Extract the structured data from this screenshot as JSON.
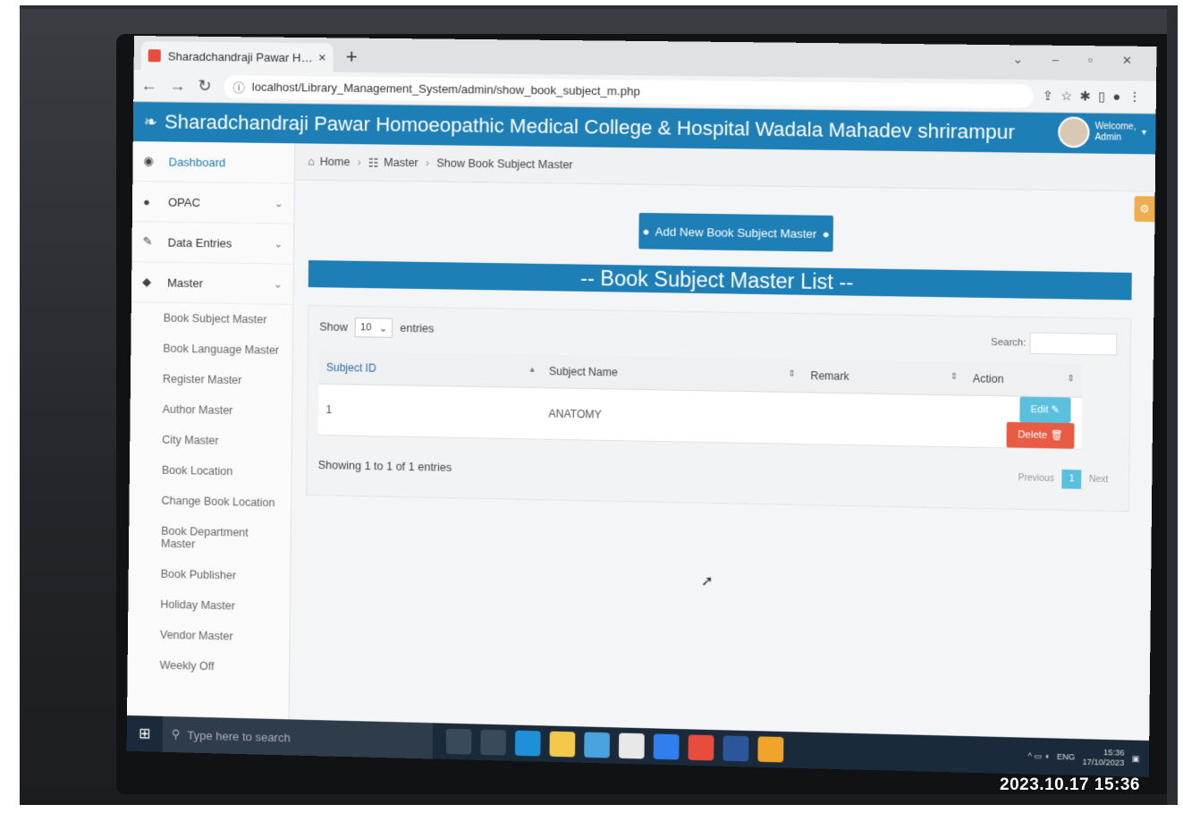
{
  "browser": {
    "tab_title": "Sharadchandraji Pawar Homoeo",
    "tab_close": "×",
    "new_tab": "+",
    "url": "localhost/Library_Management_System/admin/show_book_subject_m.php"
  },
  "header": {
    "title": "Sharadchandraji Pawar Homoeopathic Medical College & Hospital Wadala Mahadev shrirampur",
    "welcome": "Welcome,",
    "user": "Admin"
  },
  "sidebar": {
    "items": [
      {
        "label": "Dashboard",
        "icon": "dashboard-icon"
      },
      {
        "label": "OPAC",
        "icon": "user-icon"
      },
      {
        "label": "Data Entries",
        "icon": "pencil-icon"
      },
      {
        "label": "Master",
        "icon": "tag-icon"
      }
    ],
    "master_sub": [
      "Book Subject Master",
      "Book Language Master",
      "Register Master",
      "Author Master",
      "City Master",
      "Book Location",
      "Change Book Location",
      "Book Department Master",
      "Book Publisher",
      "Holiday Master",
      "Vendor Master",
      "Weekly Off"
    ]
  },
  "breadcrumb": {
    "home": "Home",
    "master": "Master",
    "current": "Show Book Subject Master"
  },
  "main": {
    "add_button": "Add New Book Subject Master",
    "list_title": "-- Book Subject Master List --",
    "show_label": "Show",
    "entries_value": "10",
    "entries_label": "entries",
    "search_label": "Search:",
    "columns": [
      "Subject ID",
      "Subject Name",
      "Remark",
      "Action"
    ],
    "rows": [
      {
        "id": "1",
        "name": "ANATOMY",
        "remark": ""
      }
    ],
    "edit_label": "Edit",
    "delete_label": "Delete",
    "info": "Showing 1 to 1 of 1 entries",
    "pager": {
      "prev": "Previous",
      "page": "1",
      "next": "Next"
    }
  },
  "taskbar": {
    "search_placeholder": "Type here to search",
    "lang": "ENG",
    "time": "15:36",
    "date": "17/10/2023"
  },
  "photo_timestamp": "2023.10.17 15:36",
  "colors": {
    "primary": "#1e7fb6",
    "edit": "#5bc0de",
    "delete": "#e85c45",
    "settings": "#f0ad4e"
  }
}
